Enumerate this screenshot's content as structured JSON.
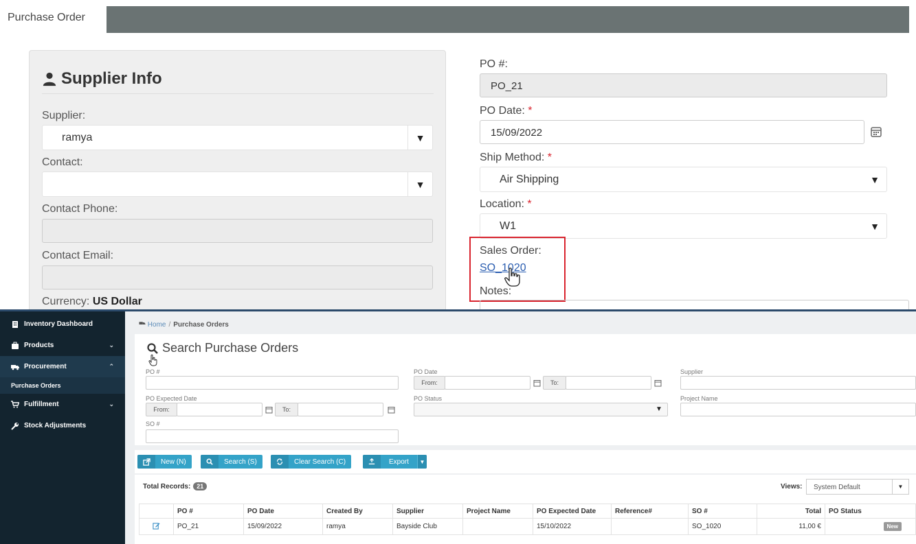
{
  "top": {
    "tab_label": "Purchase Order",
    "supplier_info": {
      "title": "Supplier Info",
      "supplier_label": "Supplier:",
      "supplier_value": "ramya",
      "contact_label": "Contact:",
      "contact_value": "",
      "contact_phone_label": "Contact Phone:",
      "contact_email_label": "Contact Email:",
      "currency_label": "Currency:",
      "currency_value": "US Dollar"
    },
    "po_form": {
      "po_number_label": "PO #:",
      "po_number_value": "PO_21",
      "po_date_label": "PO Date:",
      "po_date_value": "15/09/2022",
      "ship_method_label": "Ship Method:",
      "ship_method_value": "Air Shipping",
      "location_label": "Location:",
      "location_value": "W1",
      "sales_order_label": "Sales Order:",
      "sales_order_link": "SO_1020",
      "notes_label": "Notes:",
      "required_mark": "*"
    }
  },
  "sidebar": {
    "items": [
      {
        "label": "Inventory Dashboard"
      },
      {
        "label": "Products"
      },
      {
        "label": "Procurement"
      },
      {
        "label": "Purchase Orders"
      },
      {
        "label": "Fulfillment"
      },
      {
        "label": "Stock Adjustments"
      }
    ]
  },
  "breadcrumb": {
    "home": "Home",
    "separator": "/",
    "current": "Purchase Orders"
  },
  "search": {
    "title": "Search Purchase Orders",
    "po_label": "PO #",
    "po_date_label": "PO Date",
    "supplier_label": "Supplier",
    "po_expected_label": "PO Expected Date",
    "po_status_label": "PO Status",
    "project_name_label": "Project Name",
    "so_label": "SO #",
    "from": "From:",
    "to": "To:"
  },
  "toolbar": {
    "new_label": "New (N)",
    "search_label": "Search (S)",
    "clear_label": "Clear Search (C)",
    "export_label": "Export"
  },
  "grid": {
    "total_label": "Total Records:",
    "total_count": "21",
    "views_label": "Views:",
    "views_value": "System Default",
    "columns": [
      "PO #",
      "PO Date",
      "Created By",
      "Supplier",
      "Project Name",
      "PO Expected Date",
      "Reference#",
      "SO #",
      "Total",
      "PO Status"
    ],
    "rows": [
      {
        "po": "PO_21",
        "po_date": "15/09/2022",
        "created_by": "ramya",
        "supplier": "Bayside Club",
        "project": "",
        "expected": "15/10/2022",
        "reference": "",
        "so": "SO_1020",
        "total": "11,00 €",
        "status": "New"
      }
    ]
  },
  "colors": {
    "sidebar_bg": "#13242f",
    "accent_button": "#34a3c8",
    "highlight_red": "#d9232d",
    "top_bar": "#6a7373"
  }
}
